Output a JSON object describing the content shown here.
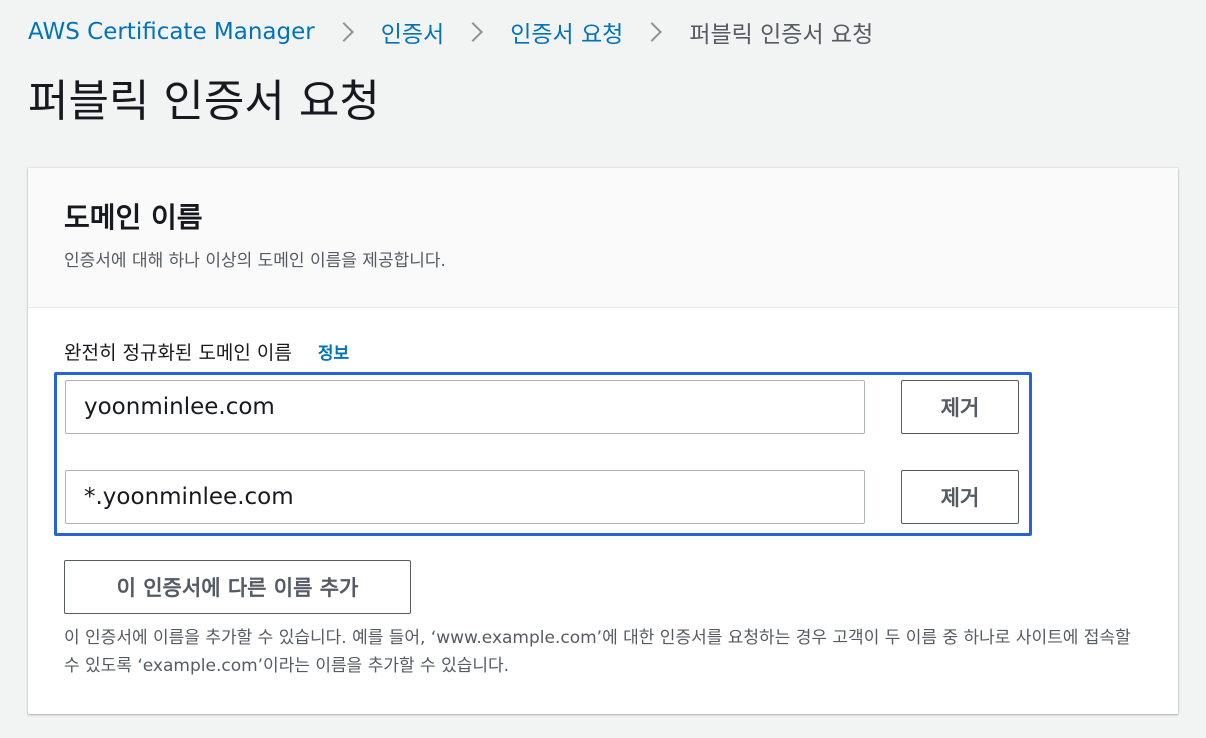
{
  "breadcrumb": {
    "items": [
      {
        "label": "AWS Certificate Manager"
      },
      {
        "label": "인증서"
      },
      {
        "label": "인증서 요청"
      }
    ],
    "current": "퍼블릭 인증서 요청"
  },
  "page": {
    "title": "퍼블릭 인증서 요청"
  },
  "panel": {
    "title": "도메인 이름",
    "description": "인증서에 대해 하나 이상의 도메인 이름을 제공합니다.",
    "field_label": "완전히 정규화된 도메인 이름",
    "info_label": "정보",
    "domains": [
      {
        "value": "yoonminlee.com",
        "remove_label": "제거"
      },
      {
        "value": "*.yoonminlee.com",
        "remove_label": "제거"
      }
    ],
    "add_button_label": "이 인증서에 다른 이름 추가",
    "help_text": "이 인증서에 이름을 추가할 수 있습니다. 예를 들어, ‘www.example.com’에 대한 인증서를 요청하는 경우 고객이 두 이름 중 하나로 사이트에 접속할 수 있도록 ‘example.com’이라는 이름을 추가할 수 있습니다."
  },
  "colors": {
    "link": "#0073bb",
    "highlight_border": "#2763d6",
    "background": "#f2f3f3"
  }
}
